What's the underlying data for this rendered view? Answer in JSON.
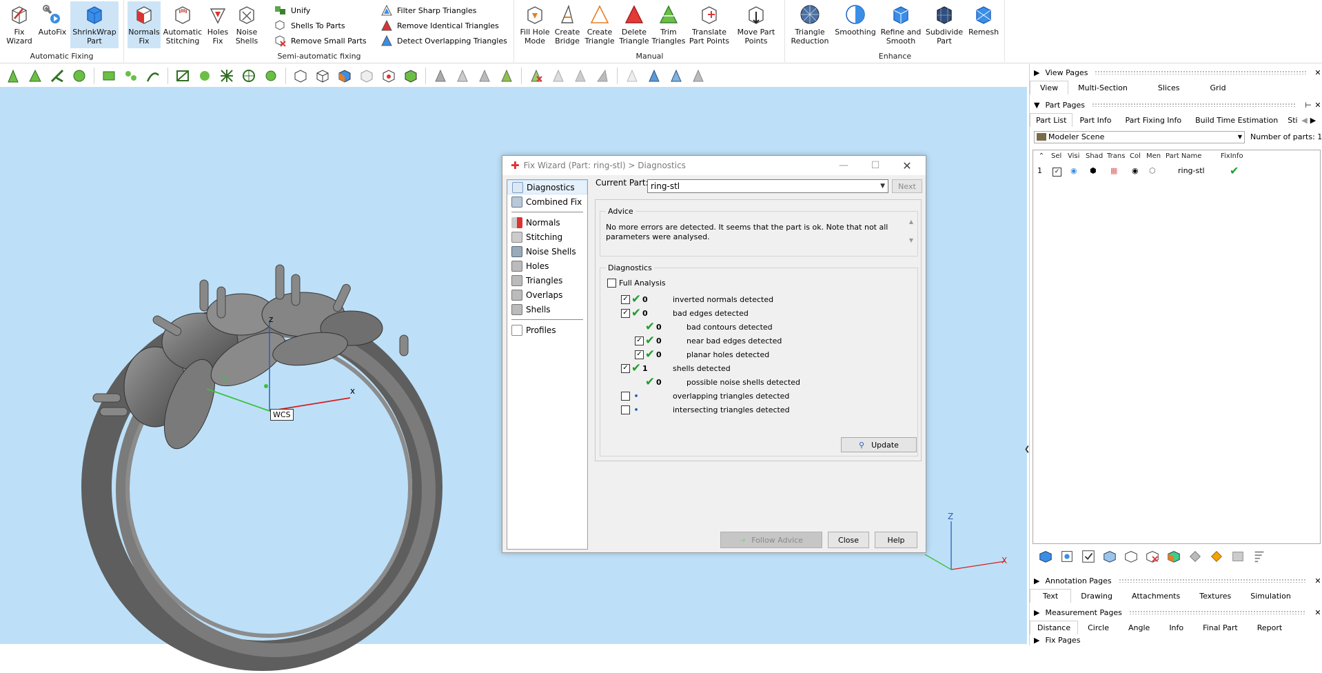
{
  "ribbon": {
    "automatic_fixing": {
      "label": "Automatic Fixing",
      "buttons": [
        {
          "label1": "Fix",
          "label2": "Wizard"
        },
        {
          "label1": "AutoFix",
          "label2": ""
        },
        {
          "label1": "ShrinkWrap",
          "label2": "Part"
        }
      ]
    },
    "semi_automatic": {
      "label": "Semi-automatic fixing",
      "buttons": [
        {
          "label1": "Normals",
          "label2": "Fix"
        },
        {
          "label1": "Automatic",
          "label2": "Stitching"
        },
        {
          "label1": "Holes",
          "label2": "Fix"
        },
        {
          "label1": "Noise",
          "label2": "Shells"
        }
      ],
      "small_buttons": [
        "Unify",
        "Shells To Parts",
        "Remove Small Parts"
      ],
      "triangle_buttons": [
        "Filter Sharp Triangles",
        "Remove Identical Triangles",
        "Detect Overlapping Triangles"
      ]
    },
    "manual": {
      "label": "Manual",
      "buttons": [
        {
          "label1": "Fill Hole",
          "label2": "Mode"
        },
        {
          "label1": "Create",
          "label2": "Bridge"
        },
        {
          "label1": "Create",
          "label2": "Triangle"
        },
        {
          "label1": "Delete",
          "label2": "Triangle"
        },
        {
          "label1": "Trim",
          "label2": "Triangles"
        },
        {
          "label1": "Translate",
          "label2": "Part Points"
        },
        {
          "label1": "Move Part",
          "label2": "Points"
        }
      ]
    },
    "enhance": {
      "label": "Enhance",
      "buttons": [
        {
          "label1": "Triangle",
          "label2": "Reduction"
        },
        {
          "label1": "Smoothing",
          "label2": ""
        },
        {
          "label1": "Refine and",
          "label2": "Smooth"
        },
        {
          "label1": "Subdivide",
          "label2": "Part"
        },
        {
          "label1": "Remesh",
          "label2": ""
        }
      ]
    }
  },
  "viewport": {
    "wcs_label": "WCS",
    "axes": {
      "x": "x",
      "y": "y",
      "z": "z"
    },
    "corner_axes": {
      "x": "X",
      "z": "Z"
    }
  },
  "dialog": {
    "title": "Fix Wizard (Part: ring-stl) > Diagnostics",
    "nav_top": [
      "Diagnostics",
      "Combined Fix"
    ],
    "nav_items": [
      "Normals",
      "Stitching",
      "Noise Shells",
      "Holes",
      "Triangles",
      "Overlaps",
      "Shells"
    ],
    "nav_bottom": [
      "Profiles"
    ],
    "current_part_label": "Current Part:",
    "current_part_value": "ring-stl",
    "next_label": "Next",
    "advice_legend": "Advice",
    "advice_text": "No more errors are detected. It seems that the part is ok. Note that not all parameters were analysed.",
    "diagnostics_legend": "Diagnostics",
    "full_analysis_label": "Full Analysis",
    "rows": [
      {
        "count": "0",
        "text": "inverted normals detected"
      },
      {
        "count": "0",
        "text": "bad edges detected"
      },
      {
        "count": "0",
        "text": "bad contours detected"
      },
      {
        "count": "0",
        "text": "near bad edges detected"
      },
      {
        "count": "0",
        "text": "planar holes detected"
      },
      {
        "count": "1",
        "text": "shells detected"
      },
      {
        "count": "0",
        "text": "possible noise shells detected"
      },
      {
        "count": "",
        "text": "overlapping triangles detected"
      },
      {
        "count": "",
        "text": "intersecting triangles detected"
      }
    ],
    "update_label": "Update",
    "follow_advice_label": "Follow Advice",
    "close_label": "Close",
    "help_label": "Help"
  },
  "right_panel": {
    "view_pages": {
      "title": "View Pages",
      "tabs": [
        "View",
        "Multi-Section",
        "Slices",
        "Grid"
      ]
    },
    "part_pages": {
      "title": "Part Pages",
      "tabs": [
        "Part List",
        "Part Info",
        "Part Fixing Info",
        "Build Time Estimation",
        "Sti"
      ]
    },
    "scene_select": "Modeler Scene",
    "number_of_parts_label": "Number of parts: 1",
    "grid_headers": [
      "Sel",
      "Visi",
      "Shad",
      "Trans",
      "Col",
      "Men",
      "Part Name",
      "FixInfo"
    ],
    "row": {
      "index": "1",
      "part_name": "ring-stl"
    },
    "annotation_pages": {
      "title": "Annotation Pages",
      "tabs": [
        "Text",
        "Drawing",
        "Attachments",
        "Textures",
        "Simulation"
      ]
    },
    "measurement_pages": {
      "title": "Measurement Pages",
      "tabs": [
        "Distance",
        "Circle",
        "Angle",
        "Info",
        "Final Part",
        "Report"
      ]
    },
    "fix_pages": {
      "title": "Fix Pages"
    }
  },
  "colors": {
    "viewport_bg": "#bde0f8",
    "ribbon_selected": "#cde4f7",
    "check_green": "#1e9e2e",
    "axis_red": "#d42020",
    "axis_green": "#3ac23a",
    "axis_blue": "#2a5fb8"
  }
}
